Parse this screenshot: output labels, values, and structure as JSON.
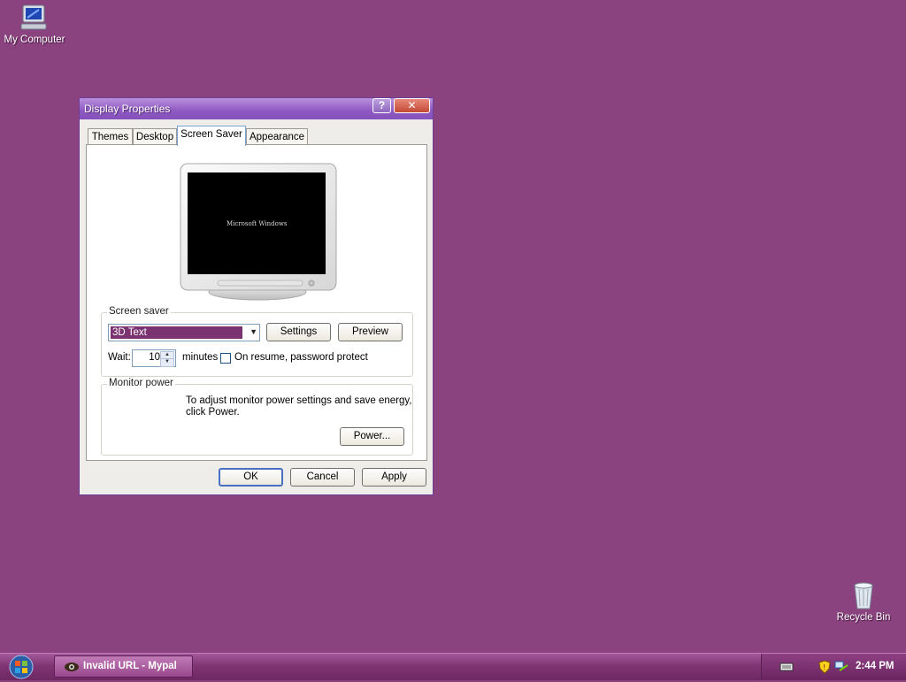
{
  "desktop": {
    "icons": [
      {
        "label": "My Computer"
      },
      {
        "label": "Recycle Bin"
      }
    ]
  },
  "window": {
    "title": "Display Properties",
    "help_glyph": "?",
    "close_glyph": "✕",
    "tabs": [
      {
        "label": "Themes"
      },
      {
        "label": "Desktop"
      },
      {
        "label": "Screen Saver"
      },
      {
        "label": "Appearance"
      }
    ],
    "preview_text": "Microsoft Windows",
    "screensaver": {
      "group_label": "Screen saver",
      "selected": "3D Text",
      "settings_label": "Settings",
      "preview_label": "Preview",
      "wait_label": "Wait:",
      "wait_value": "10",
      "minutes_label": "minutes",
      "password_label": "On resume, password protect"
    },
    "power": {
      "group_label": "Monitor power",
      "description_line1": "To adjust monitor power settings and save energy,",
      "description_line2": "click Power.",
      "button_label": "Power..."
    },
    "buttons": {
      "ok": "OK",
      "cancel": "Cancel",
      "apply": "Apply"
    }
  },
  "taskbar": {
    "task_label": "Invalid URL - Mypal",
    "clock": "2:44 PM"
  },
  "colors": {
    "desktop": "#8a437f",
    "selection": "#7b3270"
  }
}
